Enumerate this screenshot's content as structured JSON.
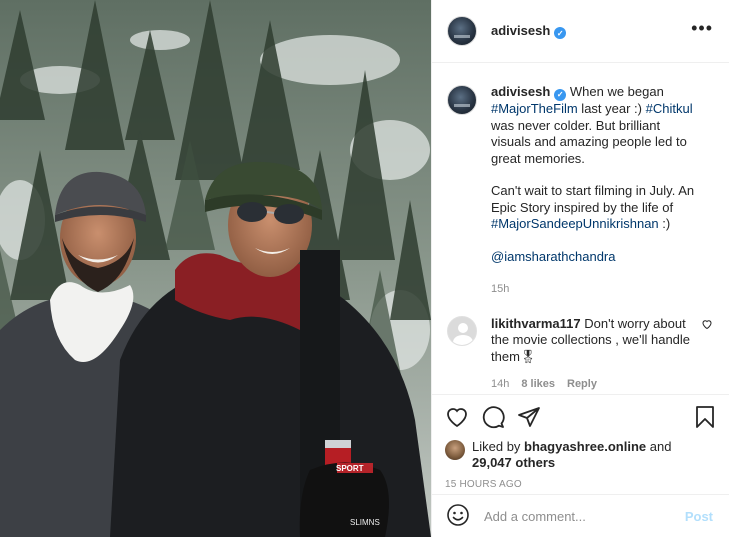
{
  "post": {
    "username": "adivisesh",
    "verified_icon": "verified-badge-icon",
    "more_icon": "more-options-icon"
  },
  "caption": {
    "username": "adivisesh",
    "part1": " When we began ",
    "tag1": "#MajorTheFilm",
    "part2": " last year :) ",
    "tag2": "#Chitkul",
    "part3": " was never colder. But brilliant visuals and amazing people led to great memories.",
    "para2_text": "Can't wait to start filming in July. An Epic Story inspired by the life of ",
    "tag3": "#MajorSandeepUnnikrishnan",
    "para2_end": " :)",
    "mention": "@iamsharathchandra",
    "time": "15h"
  },
  "comment": {
    "username": "likithvarma117",
    "text": " Don't worry about the movie collections , we'll handle them",
    "emoji": "🎖",
    "time": "14h",
    "likes": "8 likes",
    "reply": "Reply"
  },
  "actions": {
    "liked_by_prefix": "Liked by ",
    "liked_by_user": "bhagyashree.online",
    "liked_by_mid": " and",
    "others": "29,047 others",
    "timestamp": "15 HOURS AGO"
  },
  "add_comment": {
    "placeholder": "Add a comment...",
    "post_label": "Post"
  },
  "photo": {
    "can_text": "SPORT",
    "glove_text": "SLIMNS"
  },
  "colors": {
    "link": "#00376b",
    "verified": "#3897f0",
    "post_disabled": "#b2dffc",
    "secondary_text": "#8e8e8e"
  }
}
